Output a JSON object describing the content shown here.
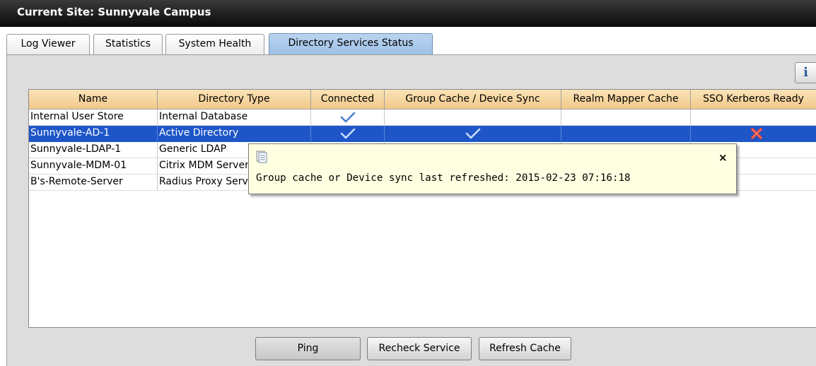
{
  "header": {
    "site_title": "Current Site:  Sunnyvale Campus"
  },
  "tabs": [
    {
      "label": "Log Viewer",
      "active": false
    },
    {
      "label": "Statistics",
      "active": false
    },
    {
      "label": "System Health",
      "active": false
    },
    {
      "label": "Directory Services Status",
      "active": true
    }
  ],
  "info_button": {
    "label": "i"
  },
  "table": {
    "columns": [
      "Name",
      "Directory Type",
      "Connected",
      "Group Cache / Device Sync",
      "Realm Mapper Cache",
      "SSO Kerberos Ready"
    ],
    "rows": [
      {
        "name": "Internal User Store",
        "type": "Internal Database",
        "connected": true,
        "group_sync": false,
        "realm": false,
        "sso": "",
        "selected": false
      },
      {
        "name": "Sunnyvale-AD-1",
        "type": "Active Directory",
        "connected": true,
        "group_sync": true,
        "realm": false,
        "sso": "failed",
        "selected": true
      },
      {
        "name": "Sunnyvale-LDAP-1",
        "type": "Generic LDAP",
        "connected": false,
        "group_sync": false,
        "realm": false,
        "sso": "",
        "selected": false
      },
      {
        "name": "Sunnyvale-MDM-01",
        "type": "Citrix MDM Server",
        "connected": false,
        "group_sync": false,
        "realm": false,
        "sso": "",
        "selected": false
      },
      {
        "name": "B's-Remote-Server",
        "type": "Radius Proxy Server",
        "connected": false,
        "group_sync": false,
        "realm": false,
        "sso": "",
        "selected": false
      }
    ]
  },
  "tooltip": {
    "close_label": "×",
    "text": "Group cache or Device sync last refreshed: 2015-02-23 07:16:18"
  },
  "buttons": {
    "ping": "Ping",
    "recheck": "Recheck Service",
    "refresh": "Refresh Cache"
  },
  "colors": {
    "selection": "#1e56c8",
    "header_bg": "#f1c98a",
    "active_tab": "#9fc1e6",
    "tooltip_bg": "#ffffe1"
  }
}
